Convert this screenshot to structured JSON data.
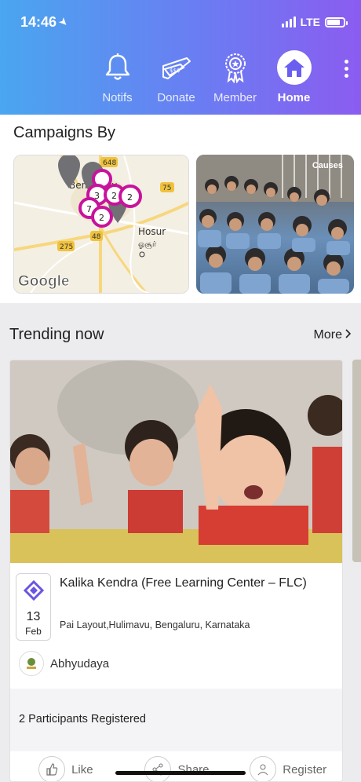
{
  "status_bar": {
    "time": "14:46",
    "network": "LTE"
  },
  "nav": [
    {
      "label": "Notifs",
      "icon": "bell-icon"
    },
    {
      "label": "Donate",
      "icon": "donate-ticket-icon"
    },
    {
      "label": "Member",
      "icon": "award-badge-icon"
    },
    {
      "label": "Home",
      "icon": "home-icon",
      "active": true
    }
  ],
  "campaigns": {
    "title": "Campaigns By",
    "map": {
      "brand": "Google",
      "place_labels": [
        "Hosur",
        "ஓசூர்",
        "Bengaluru"
      ],
      "road_labels": [
        "648",
        "75",
        "48",
        "275"
      ],
      "clusters": [
        "3",
        "2",
        "2",
        "7",
        "2"
      ]
    },
    "causes_label": "Causes"
  },
  "trending": {
    "title": "Trending now",
    "more_label": "More",
    "card": {
      "date_day": "13",
      "date_month": "Feb",
      "title": "Kalika Kendra (Free Learning Center – FLC)",
      "location": "Pai Layout,Hulimavu, Bengaluru, Karnataka",
      "org_name": "Abhyudaya",
      "participants": "2 Participants Registered",
      "actions": {
        "like": "Like",
        "share": "Share",
        "register": "Register"
      }
    }
  },
  "colors": {
    "accent": "#c7139c",
    "gradient_start": "#4aa6f0",
    "gradient_end": "#8b5cf0"
  }
}
